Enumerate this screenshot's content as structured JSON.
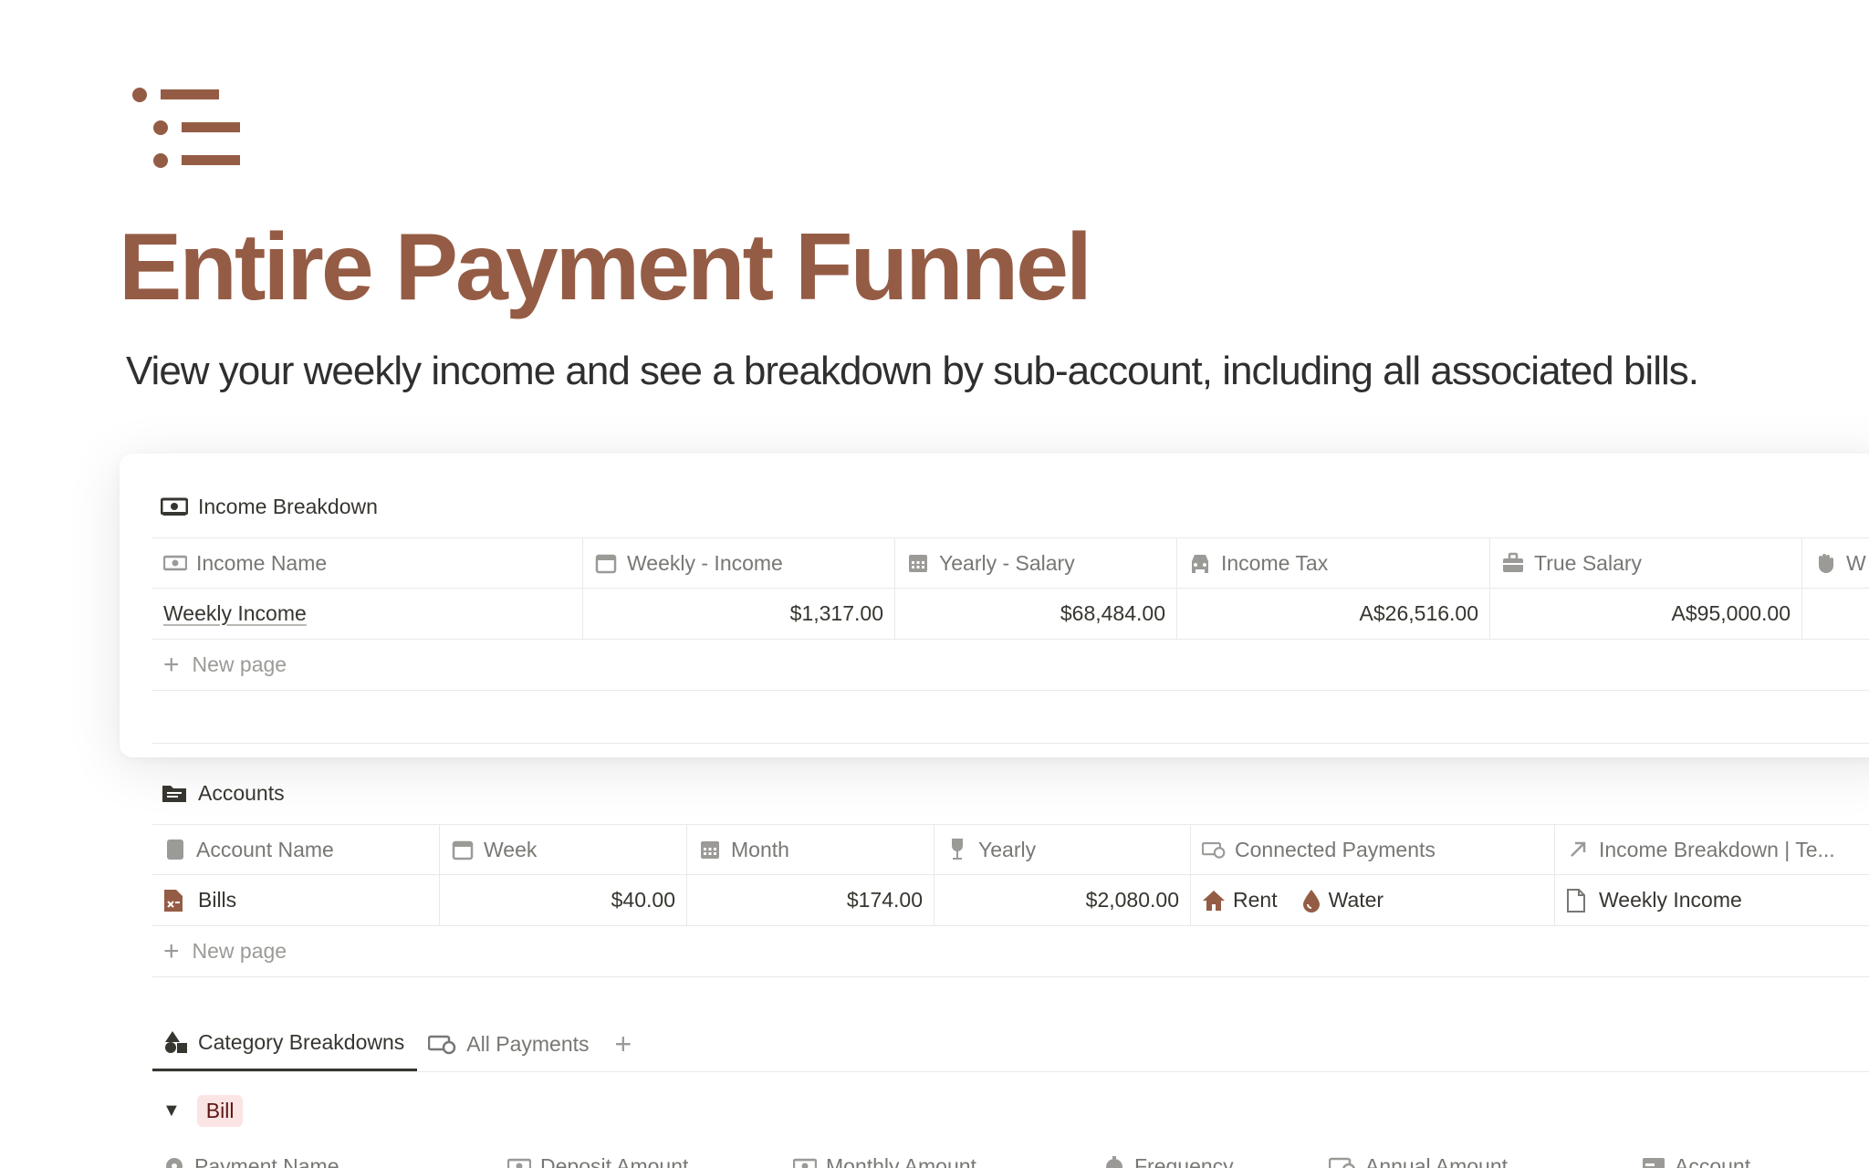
{
  "page": {
    "icon": "bullet-list-icon",
    "title": "Entire Payment Funnel",
    "description": "View your weekly income and see a breakdown by sub-account, including all associated bills."
  },
  "colors": {
    "accent": "#955c45",
    "tag_bill_bg": "#fbe4e4",
    "tag_bill_text": "#5d1715"
  },
  "income": {
    "title": "Income Breakdown",
    "columns": [
      "Income Name",
      "Weekly - Income",
      "Yearly - Salary",
      "Income Tax",
      "True Salary",
      "W"
    ],
    "rows": [
      {
        "name": "Weekly Income",
        "weekly": "$1,317.00",
        "yearly": "$68,484.00",
        "tax": "A$26,516.00",
        "true_salary": "A$95,000.00"
      }
    ],
    "new_page": "New page"
  },
  "accounts": {
    "title": "Accounts",
    "columns": [
      "Account Name",
      "Week",
      "Month",
      "Yearly",
      "Connected Payments",
      "Income Breakdown | Te..."
    ],
    "rows": [
      {
        "name": "Bills",
        "week": "$40.00",
        "month": "$174.00",
        "yearly": "$2,080.00",
        "payments": [
          "Rent",
          "Water"
        ],
        "income": "Weekly Income"
      }
    ],
    "new_page": "New page"
  },
  "tabs": {
    "items": [
      "Category Breakdowns",
      "All Payments"
    ],
    "active": "Category Breakdowns",
    "add": "+"
  },
  "group": {
    "label": "Bill"
  },
  "bills_table": {
    "columns": [
      "Payment Name",
      "Deposit Amount",
      "Monthly Amount",
      "Frequency",
      "Annual Amount",
      "Account"
    ]
  }
}
